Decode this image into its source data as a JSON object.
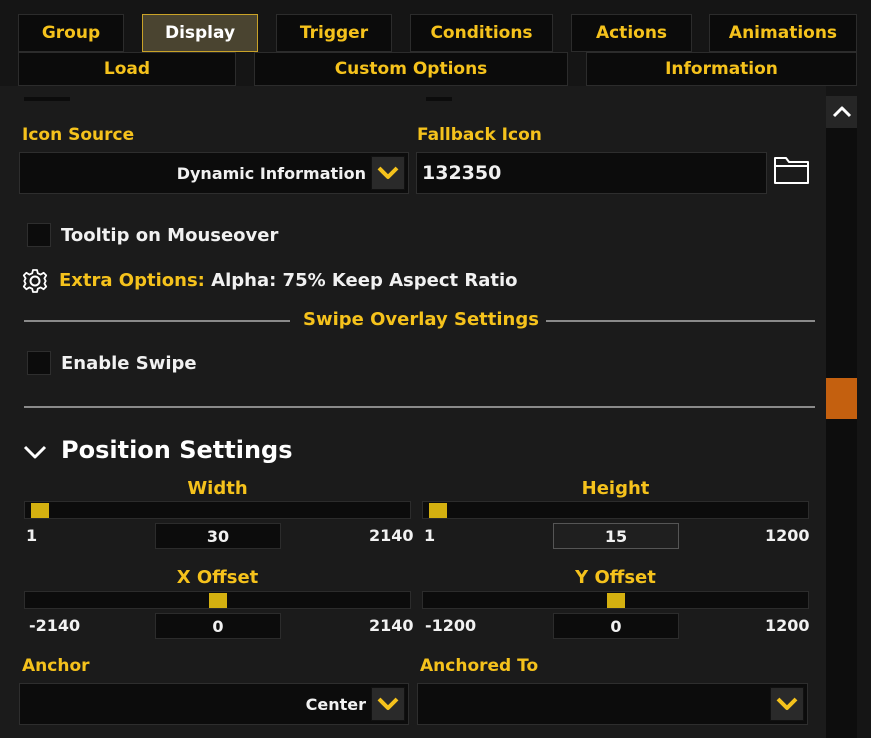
{
  "tabs_row1": [
    {
      "label": "Group"
    },
    {
      "label": "Display",
      "active": true
    },
    {
      "label": "Trigger"
    },
    {
      "label": "Conditions"
    },
    {
      "label": "Actions"
    },
    {
      "label": "Animations"
    }
  ],
  "tabs_row2": [
    {
      "label": "Load"
    },
    {
      "label": "Custom Options"
    },
    {
      "label": "Information"
    }
  ],
  "icon_source": {
    "label": "Icon Source",
    "value": "Dynamic Information"
  },
  "fallback_icon": {
    "label": "Fallback Icon",
    "value": "132350"
  },
  "tooltip": {
    "label": "Tooltip on Mouseover",
    "checked": false
  },
  "extra_options": {
    "label": "Extra Options:",
    "value": "Alpha: 75% Keep Aspect Ratio"
  },
  "swipe_header": "Swipe Overlay Settings",
  "enable_swipe": {
    "label": "Enable Swipe",
    "checked": false
  },
  "position": {
    "title": "Position Settings",
    "width": {
      "label": "Width",
      "value": "30",
      "min": "1",
      "max": "2140"
    },
    "height": {
      "label": "Height",
      "value": "15",
      "min": "1",
      "max": "1200"
    },
    "x_offset": {
      "label": "X Offset",
      "value": "0",
      "min": "-2140",
      "max": "2140"
    },
    "y_offset": {
      "label": "Y Offset",
      "value": "0",
      "min": "-1200",
      "max": "1200"
    }
  },
  "anchor": {
    "label": "Anchor",
    "value": "Center"
  },
  "anchored_to": {
    "label": "Anchored To",
    "value": ""
  },
  "colors": {
    "accent": "#f5c21c",
    "active_tab": "#4a4430",
    "scroll_thumb": "#c4600f"
  }
}
